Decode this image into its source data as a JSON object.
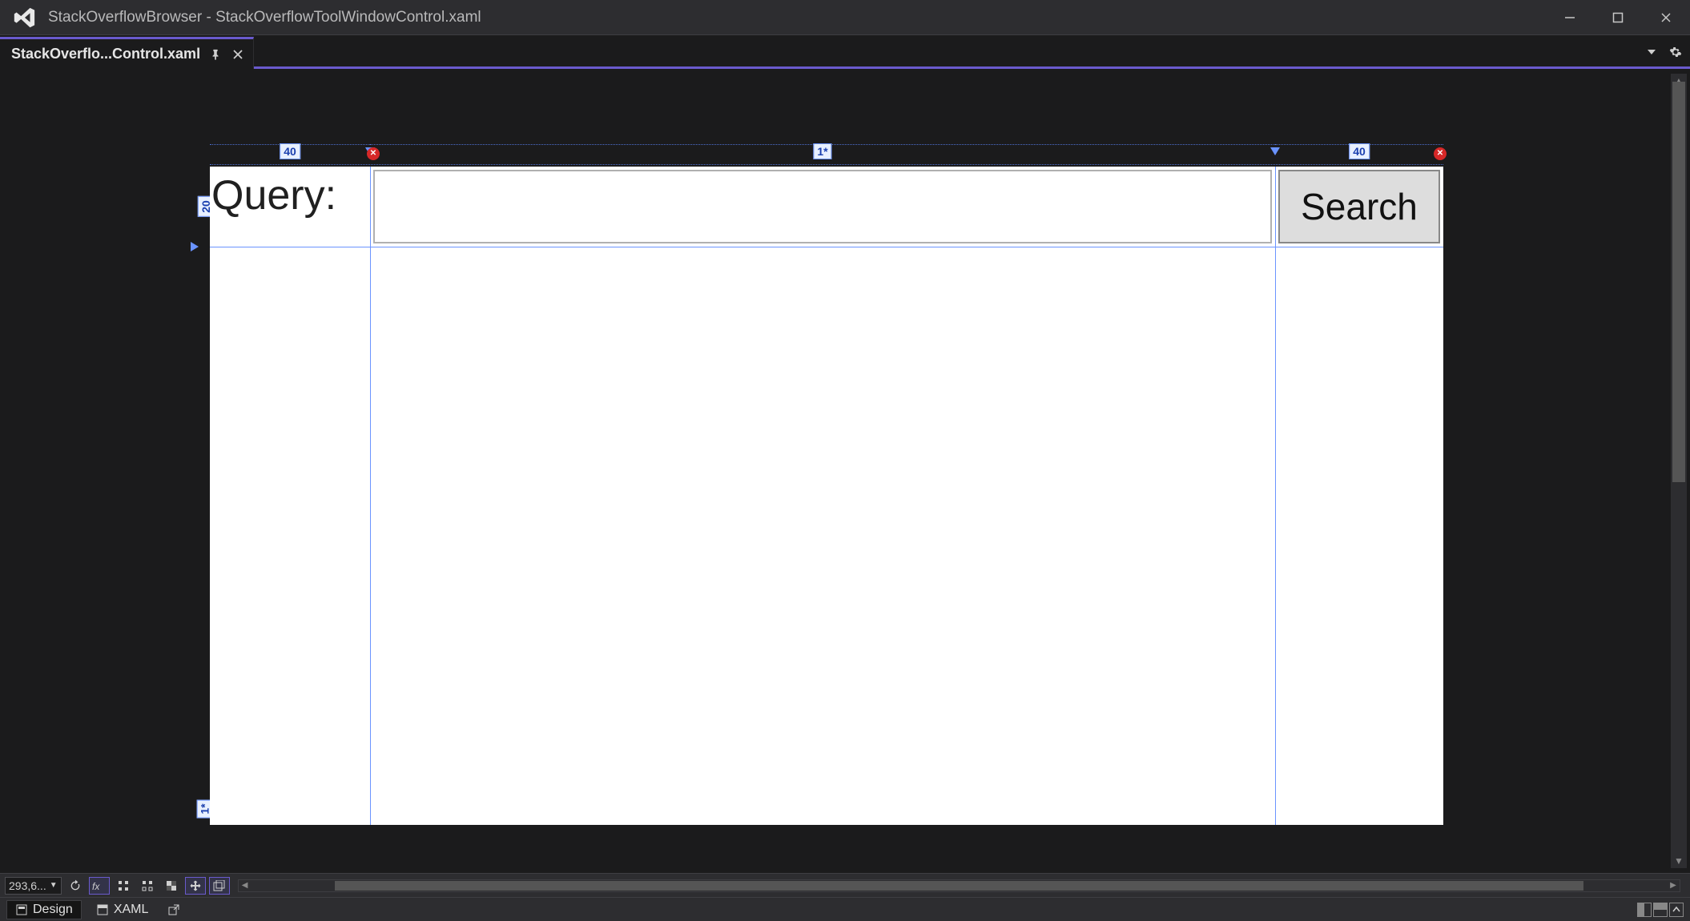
{
  "window": {
    "app_name": "StackOverflowBrowser",
    "document_name": "StackOverflowToolWindowControl.xaml",
    "title_separator": " - "
  },
  "tabs": {
    "active": {
      "label": "StackOverflo...Control.xaml"
    }
  },
  "designer": {
    "grid": {
      "columns": [
        "40",
        "1*",
        "40"
      ],
      "rows": [
        "20",
        "1*"
      ]
    },
    "control": {
      "query_label": "Query:",
      "search_button": "Search",
      "textbox_value": ""
    },
    "zoom_display": "293,6..."
  },
  "bottom_tabs": {
    "design": "Design",
    "xaml": "XAML"
  }
}
